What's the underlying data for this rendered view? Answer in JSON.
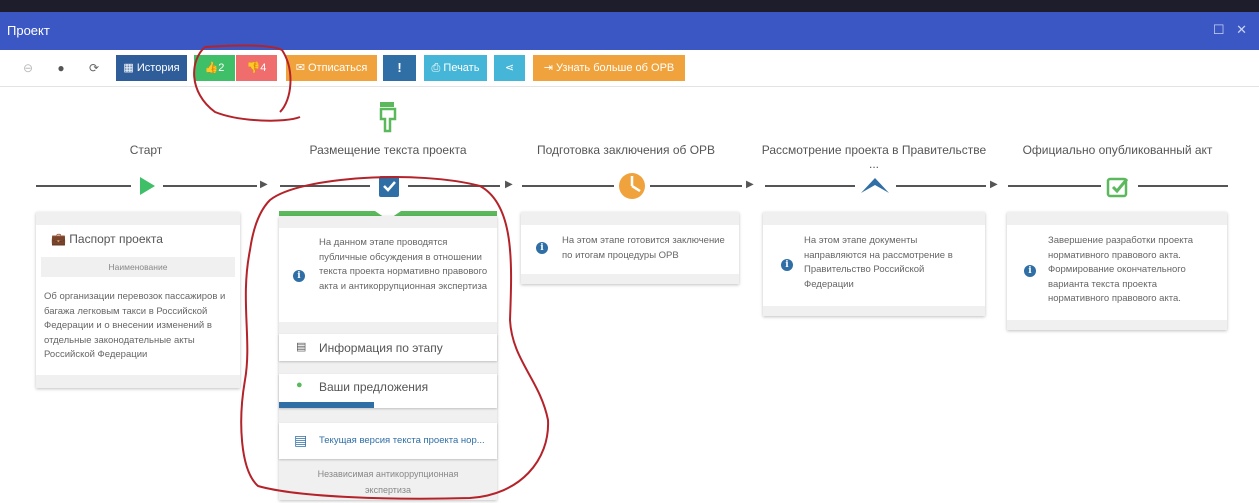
{
  "window": {
    "title": "Проект",
    "controls": "☐ ✕"
  },
  "toolbar": {
    "history_label": "История",
    "likes": "2",
    "dislikes": "4",
    "unsubscribe_label": "Отписаться",
    "print_label": "Печать",
    "learn_more_label": "Узнать больше об ОРВ",
    "alert_glyph": "!"
  },
  "steps": [
    {
      "label": "Старт"
    },
    {
      "label": "Размещение текста проекта"
    },
    {
      "label": "Подготовка заключения об ОРВ"
    },
    {
      "label": "Рассмотрение проекта в Правительстве ..."
    },
    {
      "label": "Официально опубликованный акт"
    }
  ],
  "passport": {
    "title": "Паспорт проекта",
    "section": "Наименование",
    "text": "Об организации перевозок пассажиров и багажа легковым такси в Российской Федерации и о внесении изменений в отдельные законодательные акты Российской Федерации"
  },
  "stage2": {
    "info": "На данном этапе проводятся публичные обсуждения в отношении текста проекта нормативно правового акта и антикоррупционная экспертиза",
    "stage_info_label": "Информация по этапу",
    "proposals_label": "Ваши предложения",
    "current_version_label": "Текущая версия текста проекта нор...",
    "footer": "Независимая антикоррупционная экспертиза"
  },
  "stage3": {
    "info": "На этом этапе готовится заключение по итогам процедуры ОРВ"
  },
  "stage4": {
    "info": "На этом этапе документы направляются на рассмотрение в Правительство Российской Федерации"
  },
  "stage5": {
    "info": "Завершение разработки проекта нормативного правового акта. Формирование окончательного варианта текста проекта нормативного правового акта."
  },
  "colors": {
    "titlebar": "#3b57c3",
    "history": "#2f5d9a",
    "like": "#3fbf67",
    "dislike": "#f06d6d",
    "unsubscribe": "#f0a33c",
    "alert": "#2f6fa6",
    "print": "#45b6d8",
    "learn": "#f0a33c",
    "green": "#5cb85c",
    "progress": "#2f6fa6"
  }
}
